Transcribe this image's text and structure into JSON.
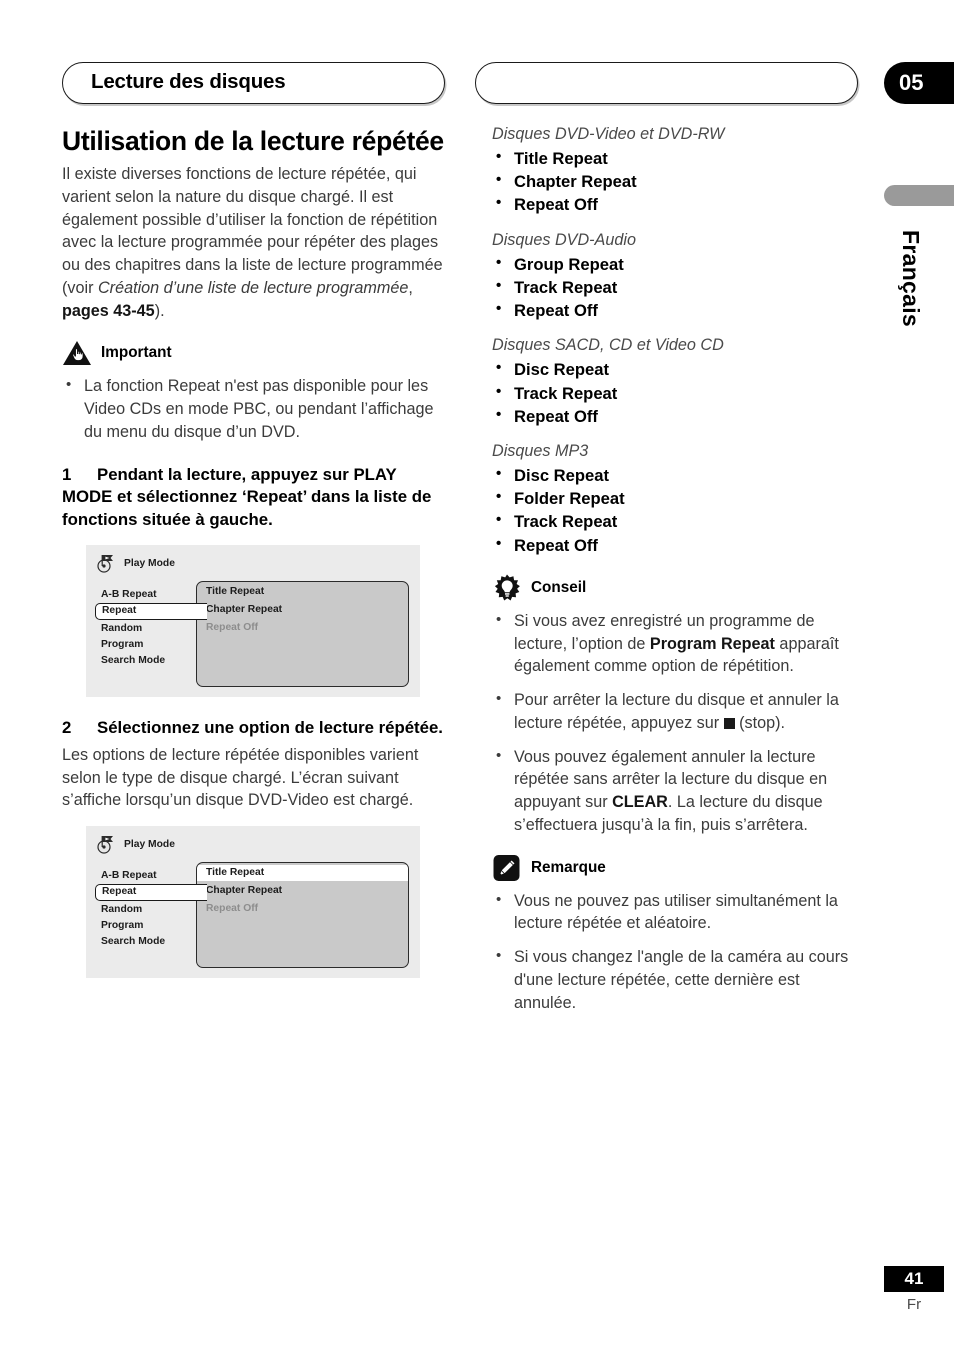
{
  "header": {
    "section_title": "Lecture des disques",
    "chapter_number": "05"
  },
  "side_tab": {
    "language": "Français"
  },
  "footer": {
    "page_number": "41",
    "language_code": "Fr"
  },
  "left_column": {
    "title": "Utilisation de la lecture répétée",
    "intro_part1": "Il existe diverses fonctions de lecture répétée, qui varient selon la nature du disque chargé. Il est également possible d’utiliser la fonction de répétition avec la lecture programmée pour répéter des plages ou des chapitres dans la liste de lecture programmée (voir ",
    "intro_italic": "Création d’une liste de lecture programmée",
    "intro_comma": ", ",
    "intro_pages": "pages 43-45",
    "intro_end": ").",
    "important": {
      "icon": "warning-triangle-hand-icon",
      "label": "Important",
      "bullets": [
        "La fonction Repeat n'est pas disponible pour les Video CDs en mode PBC, ou pendant l’affichage du menu du disque d’un DVD."
      ]
    },
    "step1": {
      "number": "1",
      "text": "Pendant la lecture, appuyez sur PLAY MODE et sélectionnez ‘Repeat’ dans la liste de fonctions située à gauche."
    },
    "step2": {
      "number": "2",
      "text": "Sélectionnez une option de lecture répétée.",
      "body": "Les options de lecture répétée disponibles varient selon le type de disque chargé. L’écran suivant s’affiche lorsqu’un disque DVD-Video est chargé."
    },
    "osd_screen_1": {
      "icon": "disc-play-mode-icon",
      "title": "Play Mode",
      "menu_items": [
        {
          "label": "A-B Repeat",
          "selected": false
        },
        {
          "label": "Repeat",
          "selected": true
        },
        {
          "label": "Random",
          "selected": false
        },
        {
          "label": "Program",
          "selected": false
        },
        {
          "label": "Search Mode",
          "selected": false
        }
      ],
      "options": [
        {
          "label": "Title Repeat",
          "highlighted": false,
          "dimmed": false
        },
        {
          "label": "Chapter Repeat",
          "highlighted": false,
          "dimmed": false
        },
        {
          "label": "Repeat Off",
          "highlighted": false,
          "dimmed": true
        }
      ]
    },
    "osd_screen_2": {
      "icon": "disc-play-mode-icon",
      "title": "Play Mode",
      "menu_items": [
        {
          "label": "A-B Repeat",
          "selected": false
        },
        {
          "label": "Repeat",
          "selected": true
        },
        {
          "label": "Random",
          "selected": false
        },
        {
          "label": "Program",
          "selected": false
        },
        {
          "label": "Search Mode",
          "selected": false
        }
      ],
      "options": [
        {
          "label": "Title Repeat",
          "highlighted": true,
          "dimmed": false
        },
        {
          "label": "Chapter Repeat",
          "highlighted": false,
          "dimmed": false
        },
        {
          "label": "Repeat Off",
          "highlighted": false,
          "dimmed": true
        }
      ]
    }
  },
  "right_column": {
    "disc_groups": [
      {
        "title": "Disques DVD-Video et DVD-RW",
        "options": [
          "Title Repeat",
          "Chapter Repeat",
          "Repeat Off"
        ]
      },
      {
        "title": "Disques DVD-Audio",
        "options": [
          "Group Repeat",
          "Track Repeat",
          "Repeat Off"
        ]
      },
      {
        "title": "Disques SACD, CD et Video CD",
        "options": [
          "Disc Repeat",
          "Track Repeat",
          "Repeat Off"
        ]
      },
      {
        "title": "Disques MP3",
        "options": [
          "Disc Repeat",
          "Folder Repeat",
          "Track Repeat",
          "Repeat Off"
        ]
      }
    ],
    "tip": {
      "icon": "lightbulb-tip-icon",
      "label": "Conseil",
      "bullet1_part1": "Si vous avez enregistré un programme de lecture, l’option de ",
      "bullet1_bold": "Program Repeat",
      "bullet1_part2": " apparaît également comme option de répétition.",
      "bullet2_part1": "Pour arrêter la lecture du disque et annuler la lecture répétée, appuyez sur ",
      "bullet2_stop_label": " (stop).",
      "bullet3_part1": "Vous pouvez également annuler la lecture répétée sans arrêter la lecture du disque en appuyant sur ",
      "bullet3_bold": "CLEAR",
      "bullet3_part2": ". La lecture du disque s’effectuera jusqu’à la fin, puis s’arrêtera."
    },
    "note": {
      "icon": "pencil-note-icon",
      "label": "Remarque",
      "bullets": [
        "Vous ne pouvez pas utiliser simultanément la lecture répétée et aléatoire.",
        "Si vous changez l'angle de la caméra au cours d'une lecture répétée, cette dernière est annulée."
      ]
    }
  }
}
